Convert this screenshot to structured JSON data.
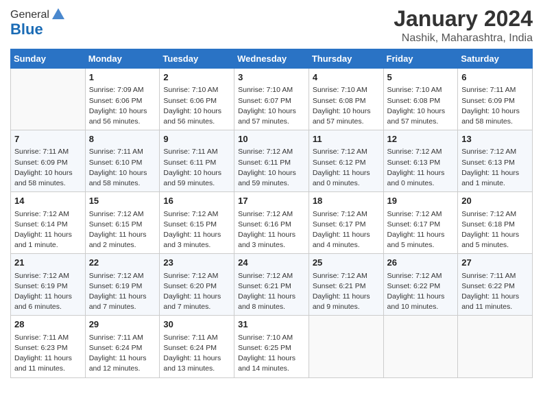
{
  "logo": {
    "general": "General",
    "blue": "Blue"
  },
  "title": "January 2024",
  "subtitle": "Nashik, Maharashtra, India",
  "days_of_week": [
    "Sunday",
    "Monday",
    "Tuesday",
    "Wednesday",
    "Thursday",
    "Friday",
    "Saturday"
  ],
  "weeks": [
    [
      {
        "num": "",
        "info": ""
      },
      {
        "num": "1",
        "info": "Sunrise: 7:09 AM\nSunset: 6:06 PM\nDaylight: 10 hours\nand 56 minutes."
      },
      {
        "num": "2",
        "info": "Sunrise: 7:10 AM\nSunset: 6:06 PM\nDaylight: 10 hours\nand 56 minutes."
      },
      {
        "num": "3",
        "info": "Sunrise: 7:10 AM\nSunset: 6:07 PM\nDaylight: 10 hours\nand 57 minutes."
      },
      {
        "num": "4",
        "info": "Sunrise: 7:10 AM\nSunset: 6:08 PM\nDaylight: 10 hours\nand 57 minutes."
      },
      {
        "num": "5",
        "info": "Sunrise: 7:10 AM\nSunset: 6:08 PM\nDaylight: 10 hours\nand 57 minutes."
      },
      {
        "num": "6",
        "info": "Sunrise: 7:11 AM\nSunset: 6:09 PM\nDaylight: 10 hours\nand 58 minutes."
      }
    ],
    [
      {
        "num": "7",
        "info": "Sunrise: 7:11 AM\nSunset: 6:09 PM\nDaylight: 10 hours\nand 58 minutes."
      },
      {
        "num": "8",
        "info": "Sunrise: 7:11 AM\nSunset: 6:10 PM\nDaylight: 10 hours\nand 58 minutes."
      },
      {
        "num": "9",
        "info": "Sunrise: 7:11 AM\nSunset: 6:11 PM\nDaylight: 10 hours\nand 59 minutes."
      },
      {
        "num": "10",
        "info": "Sunrise: 7:12 AM\nSunset: 6:11 PM\nDaylight: 10 hours\nand 59 minutes."
      },
      {
        "num": "11",
        "info": "Sunrise: 7:12 AM\nSunset: 6:12 PM\nDaylight: 11 hours\nand 0 minutes."
      },
      {
        "num": "12",
        "info": "Sunrise: 7:12 AM\nSunset: 6:13 PM\nDaylight: 11 hours\nand 0 minutes."
      },
      {
        "num": "13",
        "info": "Sunrise: 7:12 AM\nSunset: 6:13 PM\nDaylight: 11 hours\nand 1 minute."
      }
    ],
    [
      {
        "num": "14",
        "info": "Sunrise: 7:12 AM\nSunset: 6:14 PM\nDaylight: 11 hours\nand 1 minute."
      },
      {
        "num": "15",
        "info": "Sunrise: 7:12 AM\nSunset: 6:15 PM\nDaylight: 11 hours\nand 2 minutes."
      },
      {
        "num": "16",
        "info": "Sunrise: 7:12 AM\nSunset: 6:15 PM\nDaylight: 11 hours\nand 3 minutes."
      },
      {
        "num": "17",
        "info": "Sunrise: 7:12 AM\nSunset: 6:16 PM\nDaylight: 11 hours\nand 3 minutes."
      },
      {
        "num": "18",
        "info": "Sunrise: 7:12 AM\nSunset: 6:17 PM\nDaylight: 11 hours\nand 4 minutes."
      },
      {
        "num": "19",
        "info": "Sunrise: 7:12 AM\nSunset: 6:17 PM\nDaylight: 11 hours\nand 5 minutes."
      },
      {
        "num": "20",
        "info": "Sunrise: 7:12 AM\nSunset: 6:18 PM\nDaylight: 11 hours\nand 5 minutes."
      }
    ],
    [
      {
        "num": "21",
        "info": "Sunrise: 7:12 AM\nSunset: 6:19 PM\nDaylight: 11 hours\nand 6 minutes."
      },
      {
        "num": "22",
        "info": "Sunrise: 7:12 AM\nSunset: 6:19 PM\nDaylight: 11 hours\nand 7 minutes."
      },
      {
        "num": "23",
        "info": "Sunrise: 7:12 AM\nSunset: 6:20 PM\nDaylight: 11 hours\nand 7 minutes."
      },
      {
        "num": "24",
        "info": "Sunrise: 7:12 AM\nSunset: 6:21 PM\nDaylight: 11 hours\nand 8 minutes."
      },
      {
        "num": "25",
        "info": "Sunrise: 7:12 AM\nSunset: 6:21 PM\nDaylight: 11 hours\nand 9 minutes."
      },
      {
        "num": "26",
        "info": "Sunrise: 7:12 AM\nSunset: 6:22 PM\nDaylight: 11 hours\nand 10 minutes."
      },
      {
        "num": "27",
        "info": "Sunrise: 7:11 AM\nSunset: 6:22 PM\nDaylight: 11 hours\nand 11 minutes."
      }
    ],
    [
      {
        "num": "28",
        "info": "Sunrise: 7:11 AM\nSunset: 6:23 PM\nDaylight: 11 hours\nand 11 minutes."
      },
      {
        "num": "29",
        "info": "Sunrise: 7:11 AM\nSunset: 6:24 PM\nDaylight: 11 hours\nand 12 minutes."
      },
      {
        "num": "30",
        "info": "Sunrise: 7:11 AM\nSunset: 6:24 PM\nDaylight: 11 hours\nand 13 minutes."
      },
      {
        "num": "31",
        "info": "Sunrise: 7:10 AM\nSunset: 6:25 PM\nDaylight: 11 hours\nand 14 minutes."
      },
      {
        "num": "",
        "info": ""
      },
      {
        "num": "",
        "info": ""
      },
      {
        "num": "",
        "info": ""
      }
    ]
  ]
}
